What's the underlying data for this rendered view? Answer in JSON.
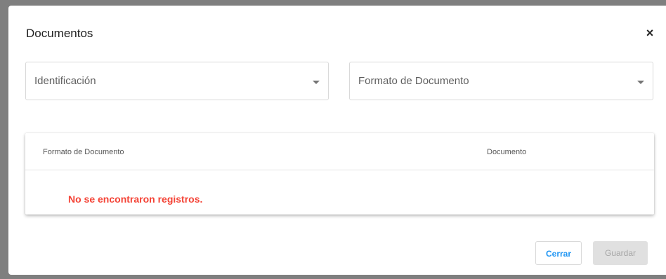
{
  "dialog": {
    "title": "Documentos",
    "close_symbol": "×"
  },
  "filters": {
    "identification": {
      "label": "Identificación",
      "icon": "chevron-down-icon"
    },
    "document_format": {
      "label": "Formato de Documento",
      "icon": "chevron-down-icon"
    }
  },
  "table": {
    "columns": [
      "Formato de Documento",
      "Documento"
    ],
    "empty_message": "No se encontraron registros.",
    "empty_color": "#f44336"
  },
  "actions": {
    "close_label": "Cerrar",
    "save_label": "Guardar",
    "accent_color": "#2196f3"
  }
}
